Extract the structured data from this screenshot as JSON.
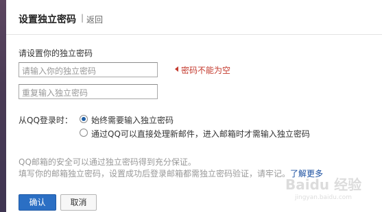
{
  "dialog": {
    "title": "设置独立密码",
    "separator": "|",
    "back_label": "返回"
  },
  "form": {
    "password_label": "请设置你的独立密码",
    "password_placeholder": "请输入你的独立密码",
    "confirm_placeholder": "重复输入独立密码",
    "error_message": "密码不能为空"
  },
  "login_option": {
    "label": "从QQ登录时：",
    "options": [
      {
        "label": "始终需要输入独立密码",
        "selected": true
      },
      {
        "label": "通过QQ可以直接处理新邮件，进入邮箱时才需输入独立密码",
        "selected": false
      }
    ]
  },
  "notes": {
    "line1": "QQ邮箱的安全可以通过独立密码得到充分保证。",
    "line2": "填写你的邮箱独立密码，设置成功后登录邮箱都需独立密码验证，请牢记。",
    "learn_more": "了解更多"
  },
  "buttons": {
    "confirm_label": "确认",
    "cancel_label": "取消"
  },
  "watermark": {
    "brand": "Baidu 经验",
    "url": "jingyan.baidu.com"
  },
  "colors": {
    "accent": "#2b6fc4",
    "error": "#c43a2e",
    "link": "#1a4fa0"
  }
}
